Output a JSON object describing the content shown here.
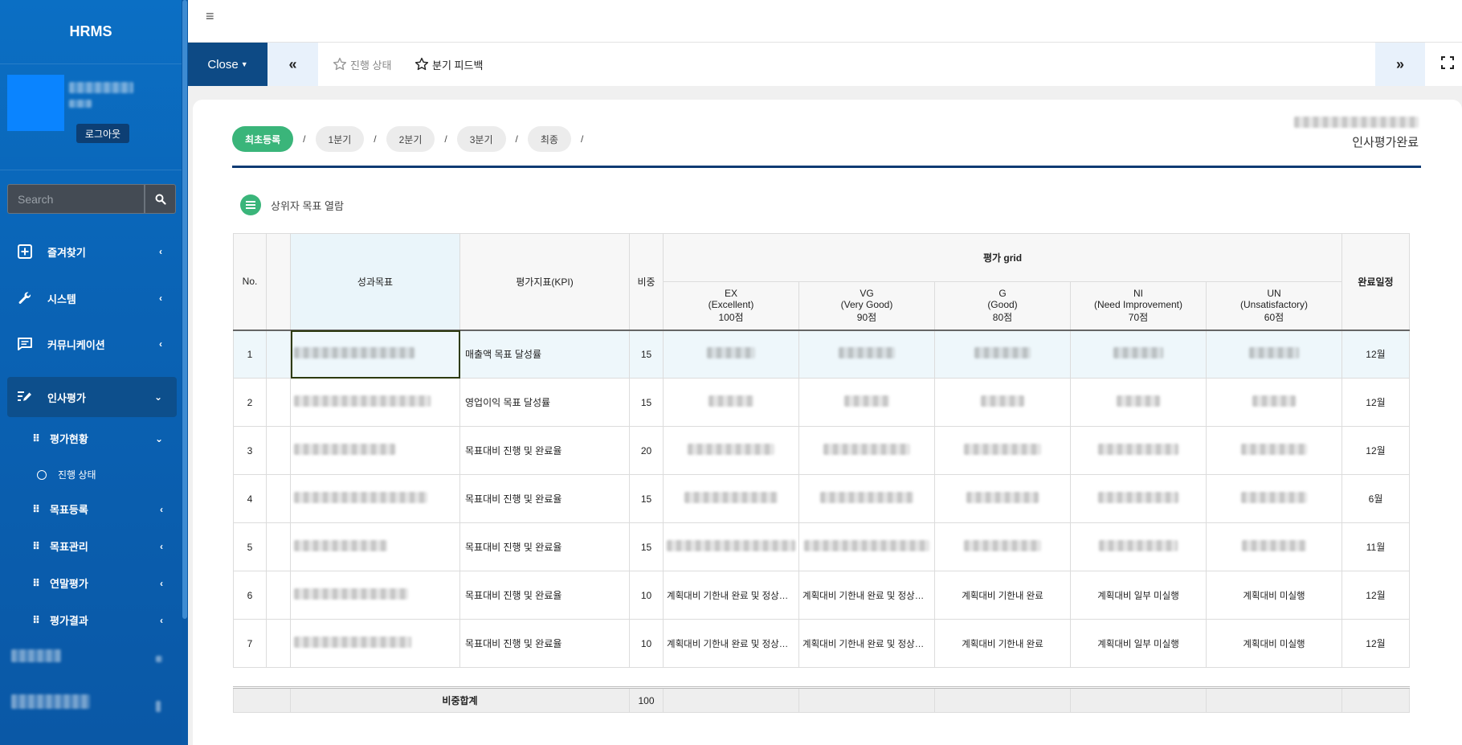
{
  "app": {
    "brand": "HRMS"
  },
  "sidebar": {
    "logout_label": "로그아웃",
    "search": {
      "placeholder": "Search"
    },
    "menu": [
      {
        "label": "즐겨찾기",
        "icon": "plus-square-icon"
      },
      {
        "label": "시스템",
        "icon": "wrench-icon"
      },
      {
        "label": "커뮤니케이션",
        "icon": "message-icon"
      },
      {
        "label": "인사평가",
        "icon": "edit-icon"
      }
    ],
    "submenu": [
      {
        "label": "평가현황"
      },
      {
        "label": "목표등록"
      },
      {
        "label": "목표관리"
      },
      {
        "label": "연말평가"
      },
      {
        "label": "평가결과"
      }
    ],
    "subsubmenu": [
      {
        "label": "진행 상태"
      }
    ]
  },
  "toolbar": {
    "close_label": "Close",
    "tab_progress": "진행 상태",
    "tab_feedback": "분기 피드백"
  },
  "steps": [
    "최초등록",
    "1분기",
    "2분기",
    "3분기",
    "최종"
  ],
  "status_text": "인사평가완료",
  "open_label": "상위자 목표 열람",
  "table": {
    "headers": {
      "no": "No.",
      "goal": "성과목표",
      "kpi": "평가지표(KPI)",
      "weight": "비중",
      "grid": "평가 grid",
      "due": "완료일정"
    },
    "grades": [
      {
        "code": "EX",
        "name": "(Excellent)",
        "score": "100점"
      },
      {
        "code": "VG",
        "name": "(Very Good)",
        "score": "90점"
      },
      {
        "code": "G",
        "name": "(Good)",
        "score": "80점"
      },
      {
        "code": "NI",
        "name": "(Need Improvement)",
        "score": "70점"
      },
      {
        "code": "UN",
        "name": "(Unsatisfactory)",
        "score": "60점"
      }
    ],
    "rows": [
      {
        "no": "1",
        "kpi": "매출액 목표 달성률",
        "weight": "15",
        "due": "12월"
      },
      {
        "no": "2",
        "kpi": "영업이익 목표 달성률",
        "weight": "15",
        "due": "12월"
      },
      {
        "no": "3",
        "kpi": "목표대비 진행 및 완료율",
        "weight": "20",
        "due": "12월"
      },
      {
        "no": "4",
        "kpi": "목표대비 진행 및 완료율",
        "weight": "15",
        "due": "6월"
      },
      {
        "no": "5",
        "kpi": "목표대비 진행 및 완료율",
        "weight": "15",
        "due": "11월"
      },
      {
        "no": "6",
        "kpi": "목표대비 진행 및 완료율",
        "weight": "10",
        "due": "12월",
        "grid": [
          "계획대비 기한내 완료 및 정상운영",
          "계획대비 기한내 완료 및 정상운영",
          "계획대비 기한내 완료",
          "계획대비 일부 미실행",
          "계획대비 미실행"
        ]
      },
      {
        "no": "7",
        "kpi": "목표대비 진행 및 완료율",
        "weight": "10",
        "due": "12월",
        "grid": [
          "계획대비 기한내 완료 및 정상운영",
          "계획대비 기한내 완료 및 정상운영",
          "계획대비 기한내 완료",
          "계획대비 일부 미실행",
          "계획대비 미실행"
        ]
      }
    ],
    "sum_label": "비중합계",
    "sum_value": "100"
  }
}
